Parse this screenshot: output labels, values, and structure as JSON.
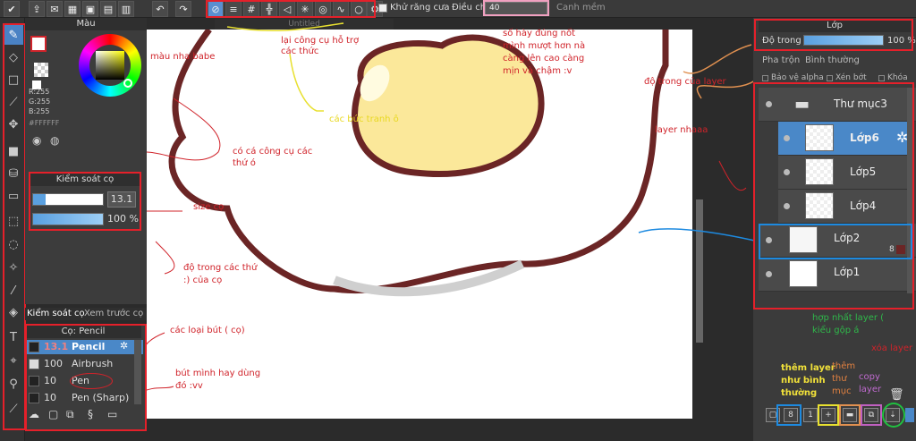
{
  "toolbar": {
    "antialias_label": "Khử răng cưa",
    "adjust_label": "Điều chỉnh",
    "adjust_value": "40",
    "smooth_label": "Canh mềm"
  },
  "color_panel": {
    "title": "Màu",
    "r": "R:255",
    "g": "G:255",
    "b": "B:255",
    "hex": "#FFFFFF"
  },
  "brush_control": {
    "title": "Kiểm soát cọ",
    "size": "13.1",
    "opacity": "100 %",
    "opacity_fraction": 1.0
  },
  "left_tabs": {
    "tab1": "Kiểm soát cọ",
    "tab2": "Xem trước cọ"
  },
  "brush_list": {
    "title": "Cọ: Pencil",
    "items": [
      {
        "size": "13.1",
        "name": "Pencil",
        "selected": true
      },
      {
        "size": "100",
        "name": "Airbrush",
        "selected": false
      },
      {
        "size": "10",
        "name": "Pen",
        "selected": false
      },
      {
        "size": "10",
        "name": "Pen (Sharp)",
        "selected": false
      }
    ]
  },
  "canvas": {
    "tab": "Untitled"
  },
  "layer_panel": {
    "title": "Lớp",
    "opacity_label": "Độ trong",
    "opacity_value": "100 %",
    "opacity_fraction": 1.0,
    "blend_label": "Pha trộn",
    "blend_value": "Bình thường",
    "protect_alpha": "Bảo vệ alpha",
    "clip": "Xén bớt",
    "lock": "Khóa",
    "layers": [
      {
        "name": "Thư mục3",
        "type": "folder"
      },
      {
        "name": "Lớp6",
        "type": "layer",
        "selected": true
      },
      {
        "name": "Lớp5",
        "type": "layer"
      },
      {
        "name": "Lớp4",
        "type": "layer"
      },
      {
        "name": "Lớp2",
        "type": "layer",
        "badge": "8"
      },
      {
        "name": "Lớp1",
        "type": "layer"
      }
    ]
  },
  "annotations": {
    "color_note": "màu nha babe",
    "toolbar_note_1": "lại công cụ hỗ trợ",
    "toolbar_note_2": "các thức",
    "smooth_note_1": "số hày đúng nốt",
    "smooth_note_2": "mình mượt hơn nà",
    "smooth_note_3": "càng lên cao càng",
    "smooth_note_4": "mịn và chậm :v",
    "canvas_note": "các bức tranh ô",
    "tools_note_1": "có cá công cụ các",
    "tools_note_2": "thứ ó",
    "size_note": "size cọ",
    "opacity_note_1": "độ trong các thứ",
    "opacity_note_2": ":)    của cọ",
    "brush_types_note": "các loại bút  ( cọ)",
    "fav_pen_note_1": "bút mình hay dùng",
    "fav_pen_note_2": "đó :vv",
    "layer_opacity_note": "độ trong của layer",
    "layer_note": "layer nhaaa",
    "merge_note_1": "hợp nhất layer  (",
    "merge_note_2": "kiểu gộp á",
    "delete_note": "xóa layer",
    "new_layer_note_1": "thêm layer",
    "new_layer_note_2": "như bình",
    "new_layer_note_3": "thường",
    "new_folder_note_1": "thêm",
    "new_folder_note_2": "thư",
    "new_folder_note_3": "mục",
    "copy_note_1": "copy",
    "copy_note_2": "layer"
  },
  "colors": {
    "accent": "#4a88c8",
    "annotation": "#d0232a",
    "egg_outline": "#6b2525",
    "yolk": "#fbe89a"
  }
}
